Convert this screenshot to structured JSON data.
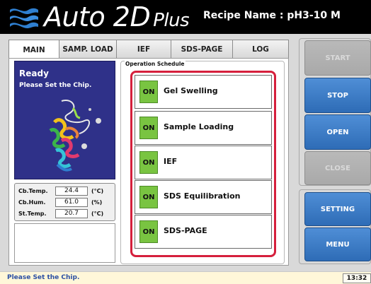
{
  "header": {
    "app_title_main": "Auto 2D",
    "app_title_plus": "Plus",
    "recipe": "Recipe Name : pH3-10 M"
  },
  "tabs": [
    {
      "label": "MAIN",
      "active": true
    },
    {
      "label": "SAMP. LOAD",
      "active": false
    },
    {
      "label": "IEF",
      "active": false
    },
    {
      "label": "SDS-PAGE",
      "active": false
    },
    {
      "label": "LOG",
      "active": false
    }
  ],
  "status_panel": {
    "title": "Ready",
    "message": "Please Set the Chip."
  },
  "readings": [
    {
      "label": "Cb.Temp.",
      "value": "24.4",
      "unit": "(°C)"
    },
    {
      "label": "Cb.Hum.",
      "value": "61.0",
      "unit": "(%)"
    },
    {
      "label": "St.Temp.",
      "value": "20.7",
      "unit": "(°C)"
    }
  ],
  "schedule": {
    "label": "Operation Schedule",
    "steps": [
      {
        "state": "ON",
        "name": "Gel Swelling"
      },
      {
        "state": "ON",
        "name": "Sample Loading"
      },
      {
        "state": "ON",
        "name": "IEF"
      },
      {
        "state": "ON",
        "name": "SDS Equilibration"
      },
      {
        "state": "ON",
        "name": "SDS-PAGE"
      }
    ]
  },
  "buttons": {
    "start": "START",
    "stop": "STOP",
    "open": "OPEN",
    "close": "CLOSE",
    "setting": "SETTING",
    "menu": "MENU"
  },
  "statusbar": {
    "message": "Please Set the Chip.",
    "time": "13:32"
  },
  "colors": {
    "schedule_highlight": "#d51f3c",
    "on_badge": "#79c441",
    "button_blue": "#3d7cc6",
    "status_panel_bg": "#2f3189"
  }
}
